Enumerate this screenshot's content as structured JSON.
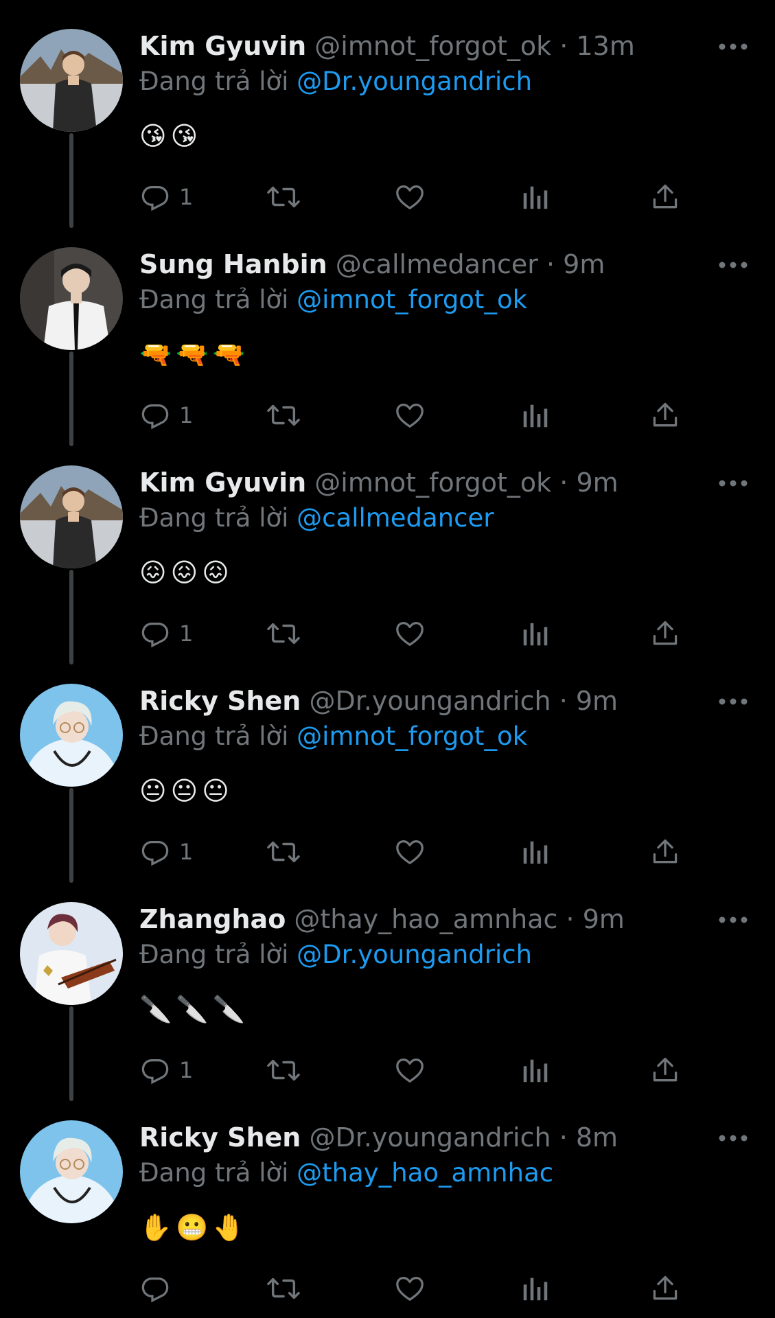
{
  "replying_label": "Đang trả lời",
  "tweets": [
    {
      "name": "Kim Gyuvin",
      "handle": "@imnot_forgot_ok",
      "sep": "·",
      "time": "13m",
      "replying_to": "@Dr.youngandrich",
      "content": "😘😘",
      "reply_count": "1",
      "avatar": "kim-gyuvin"
    },
    {
      "name": "Sung Hanbin",
      "handle": "@callmedancer",
      "sep": "·",
      "time": "9m",
      "replying_to": "@imnot_forgot_ok",
      "content": "🔫🔫🔫",
      "reply_count": "1",
      "avatar": "sung-hanbin"
    },
    {
      "name": "Kim Gyuvin",
      "handle": "@imnot_forgot_ok",
      "sep": "·",
      "time": "9m",
      "replying_to": "@callmedancer",
      "content": "😖😖😖",
      "reply_count": "1",
      "avatar": "kim-gyuvin"
    },
    {
      "name": "Ricky Shen",
      "handle": "@Dr.youngandrich",
      "sep": "·",
      "time": "9m",
      "replying_to": "@imnot_forgot_ok",
      "content": "😐😐😐",
      "reply_count": "1",
      "avatar": "ricky-shen"
    },
    {
      "name": "Zhanghao",
      "handle": "@thay_hao_amnhac",
      "sep": "·",
      "time": "9m",
      "replying_to": "@Dr.youngandrich",
      "content": "🔪🔪🔪",
      "reply_count": "1",
      "avatar": "zhanghao"
    },
    {
      "name": "Ricky Shen",
      "handle": "@Dr.youngandrich",
      "sep": "·",
      "time": "8m",
      "replying_to": "@thay_hao_amnhac",
      "content": "✋😬🤚",
      "reply_count": "",
      "avatar": "ricky-shen"
    }
  ],
  "icons": {
    "reply": "reply-icon",
    "retweet": "retweet-icon",
    "like": "heart-icon",
    "views": "analytics-icon",
    "share": "share-icon",
    "more": "more-icon"
  },
  "colors": {
    "background": "#000000",
    "text": "#e7e9ea",
    "secondary": "#71767b",
    "link": "#1d9bf0",
    "thread_line": "#3e4144"
  }
}
